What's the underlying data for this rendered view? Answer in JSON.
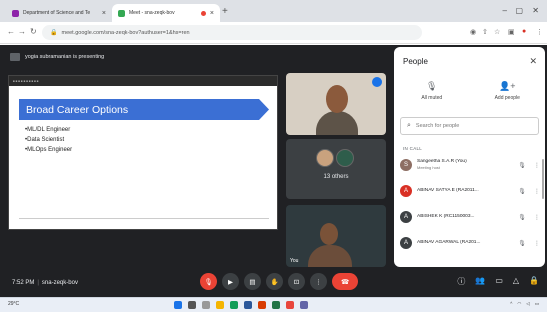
{
  "browser": {
    "tabs": [
      {
        "label": "Department of Science and Te",
        "active": false
      },
      {
        "label": "Meet - sna-zeqk-bov",
        "active": true
      }
    ],
    "url": "meet.google.com/sna-zeqk-bov?authuser=1&hs=ren"
  },
  "meet": {
    "presenter_label": "yogia subramanian is presenting",
    "slide": {
      "title": "Broad Career Options",
      "bullets": [
        "ML/DL Engineer",
        "Data Scientist",
        "MLOps Engineer"
      ]
    },
    "others_label": "13 others",
    "tile_name": "You",
    "time": "7:52 PM",
    "meeting_code": "sna-zeqk-bov"
  },
  "people_panel": {
    "title": "People",
    "actions": [
      {
        "label": "All muted",
        "icon": "mic-off-icon"
      },
      {
        "label": "Add people",
        "icon": "add-person-icon"
      }
    ],
    "search_placeholder": "Search for people",
    "section_label": "IN CALL",
    "participants": [
      {
        "name": "Sangeetha S.A.R (You)",
        "sub": "Meeting host",
        "initial": "S",
        "color": "#8d6e63"
      },
      {
        "name": "ABINAV SATYA E (RA2011...",
        "sub": "",
        "initial": "A",
        "color": "#d93025"
      },
      {
        "name": "ABISHEK K (RC1150003...",
        "sub": "",
        "initial": "A",
        "color": "#3c4043"
      },
      {
        "name": "ABINAV AGARWAL (RA201...",
        "sub": "",
        "initial": "A",
        "color": "#3c4043"
      }
    ]
  },
  "taskbar": {
    "weather": "29°C"
  },
  "colors": {
    "meet_bg": "#202124",
    "slide_title_bg": "#3b6fd4",
    "end_call": "#ea4335",
    "accent_blue": "#1a73e8"
  }
}
